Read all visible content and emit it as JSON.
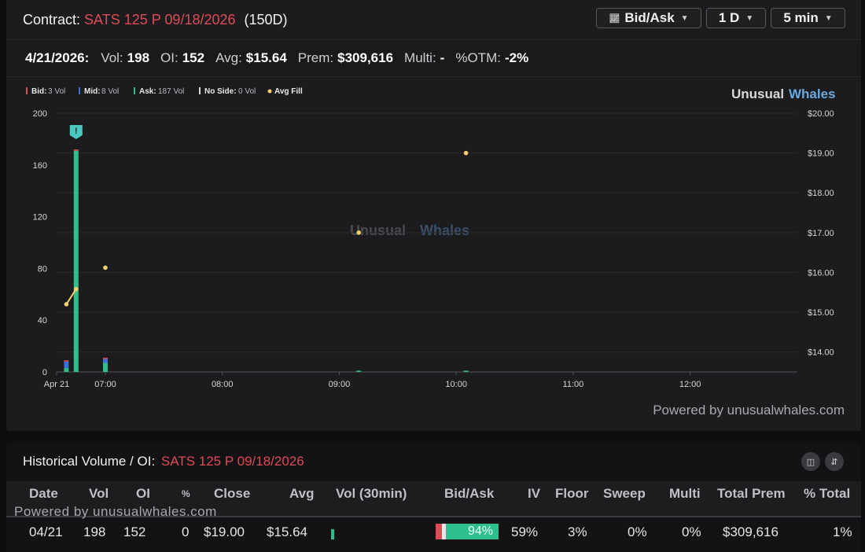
{
  "header": {
    "label": "Contract:",
    "contract": "SATS 125 P 09/18/2026",
    "days": "(150D)"
  },
  "controls": {
    "view_label": "Bid/Ask",
    "range_label": "1 D",
    "interval_label": "5 min"
  },
  "stats": {
    "date": "4/21/2026:",
    "vol_key": "Vol:",
    "vol": "198",
    "oi_key": "OI:",
    "oi": "152",
    "avg_key": "Avg:",
    "avg": "$15.64",
    "prem_key": "Prem:",
    "prem": "$309,616",
    "multi_key": "Multi:",
    "multi": "-",
    "otm_key": "%OTM:",
    "otm": "-2%"
  },
  "legend": {
    "bid": "Bid:",
    "bid_vol": "3 Vol",
    "mid": "Mid:",
    "mid_vol": "8 Vol",
    "ask": "Ask:",
    "ask_vol": "187 Vol",
    "noside": "No Side:",
    "noside_vol": "0 Vol",
    "avg_fill": "Avg Fill"
  },
  "brand": {
    "word1": "Unusual",
    "word2": "Whales"
  },
  "powered_by": "Powered by unusualwhales.com",
  "colors": {
    "bid": "#e04a55",
    "mid": "#3b6fe0",
    "ask": "#2fbf8c",
    "no_side": "#d8d8d8",
    "avg_fill": "#f5cf6b",
    "contract": "#e04a55",
    "brand_accent": "#6aa8e0"
  },
  "chart_data": {
    "type": "bar",
    "x_ticks": [
      "Apr 21",
      "07:00",
      "08:00",
      "09:00",
      "10:00",
      "11:00",
      "12:00"
    ],
    "y_left_ticks": [
      "200",
      "160",
      "120",
      "80",
      "40",
      "0"
    ],
    "y_right_ticks": [
      "$20.00",
      "$19.00",
      "$18.00",
      "$17.00",
      "$16.00",
      "$15.00",
      "$14.00"
    ],
    "ylim_left": [
      0,
      200
    ],
    "ylim_right": [
      13.5,
      20
    ],
    "grid": true,
    "series": [
      {
        "name": "Bid",
        "values": [
          {
            "t": "06:40",
            "v": 1
          },
          {
            "t": "06:45",
            "v": 1
          },
          {
            "t": "07:00",
            "v": 1
          }
        ]
      },
      {
        "name": "Mid",
        "values": [
          {
            "t": "06:40",
            "v": 5
          },
          {
            "t": "07:00",
            "v": 3
          }
        ]
      },
      {
        "name": "Ask",
        "values": [
          {
            "t": "06:40",
            "v": 3
          },
          {
            "t": "06:45",
            "v": 171
          },
          {
            "t": "07:00",
            "v": 7
          },
          {
            "t": "09:10",
            "v": 1
          },
          {
            "t": "10:05",
            "v": 1
          }
        ]
      },
      {
        "name": "No Side",
        "values": []
      }
    ],
    "avg_fill": [
      {
        "t": "06:40",
        "price": 15.2
      },
      {
        "t": "06:45",
        "price": 15.58
      },
      {
        "t": "07:00",
        "price": 16.12
      },
      {
        "t": "09:10",
        "price": 17.0
      },
      {
        "t": "10:05",
        "price": 19.0
      }
    ],
    "annotations": [
      {
        "t": "06:45",
        "label": "!"
      }
    ]
  },
  "history": {
    "label": "Historical Volume / OI:",
    "contract": "SATS 125 P 09/18/2026",
    "columns": [
      "Date",
      "Vol",
      "OI",
      "%",
      "Close",
      "Avg",
      "Vol (30min)",
      "Bid/Ask",
      "IV",
      "Floor",
      "Sweep",
      "Multi",
      "Total Prem",
      "% Total"
    ],
    "rows": [
      {
        "date": "04/21",
        "vol": "198",
        "oi": "152",
        "pct": "0",
        "close": "$19.00",
        "avg": "$15.64",
        "bid_ask_pct": "94%",
        "iv": "59%",
        "floor": "3%",
        "sweep": "0%",
        "multi": "0%",
        "total_prem": "$309,616",
        "pct_total": "1%"
      }
    ]
  }
}
